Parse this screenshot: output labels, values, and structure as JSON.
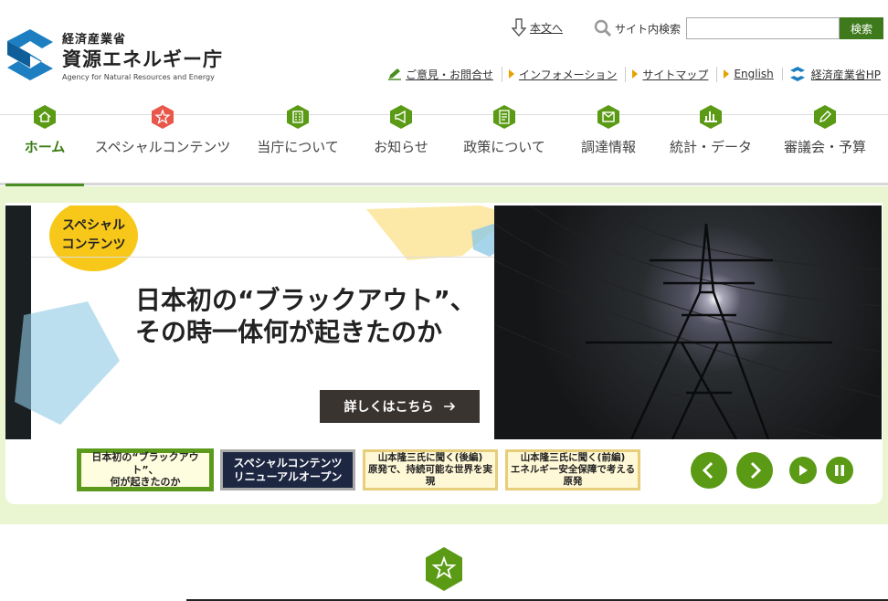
{
  "header": {
    "ministry": "経済産業省",
    "agency": "資源エネルギー庁",
    "agency_en": "Agency for Natural Resources and Energy",
    "skip_link": "本文へ",
    "search_label": "サイト内検索",
    "search_value": "",
    "search_button": "検索"
  },
  "util_links": [
    {
      "label": "ご意見・お問合せ",
      "icon": "pencil-icon"
    },
    {
      "label": "インフォメーション",
      "icon": "triangle-icon"
    },
    {
      "label": "サイトマップ",
      "icon": "triangle-icon"
    },
    {
      "label": "English",
      "icon": "triangle-icon"
    },
    {
      "label": "経済産業省HP",
      "icon": "meti-logo-icon"
    }
  ],
  "nav": [
    {
      "label": "ホーム",
      "icon": "home-icon",
      "active": true
    },
    {
      "label": "スペシャルコンテンツ",
      "icon": "star-icon"
    },
    {
      "label": "当庁について",
      "icon": "building-icon"
    },
    {
      "label": "お知らせ",
      "icon": "megaphone-icon"
    },
    {
      "label": "政策について",
      "icon": "document-icon"
    },
    {
      "label": "調達情報",
      "icon": "envelope-icon"
    },
    {
      "label": "統計・データ",
      "icon": "bar-chart-icon"
    },
    {
      "label": "審議会・予算",
      "icon": "pencil-icon"
    }
  ],
  "hero": {
    "badge_line1": "スペシャル",
    "badge_line2": "コンテンツ",
    "headline_line1": "日本初の“ブラックアウト”、",
    "headline_line2": "その時一体何が起きたのか",
    "detail_button": "詳しくはこちら",
    "photo_icon": "power-tower-photo"
  },
  "thumbs": [
    {
      "line1": "日本初の“ブラックアウト”、",
      "line2": "何が起きたのか"
    },
    {
      "line1": "スペシャルコンテンツ",
      "line2": "リニューアルオープン"
    },
    {
      "line1": "山本隆三氏に聞く(後編)",
      "line2": "原発で、持続可能な世界を実現"
    },
    {
      "line1": "山本隆三氏に聞く(前編)",
      "line2": "エネルギー安全保障で考える原発"
    }
  ],
  "controls": {
    "prev": "chevron-left-icon",
    "next": "chevron-right-icon",
    "play": "play-icon",
    "pause": "pause-icon"
  },
  "colors": {
    "brand_green": "#5a9a14",
    "accent_blue": "#1d7fc1",
    "band_bg": "#eaf5d2",
    "badge_yellow": "#f7c71a",
    "star_red": "#e8574a"
  }
}
